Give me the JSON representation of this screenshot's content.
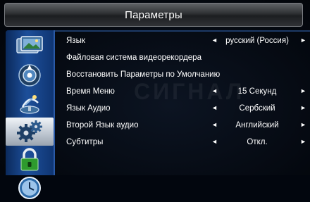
{
  "title": "Параметры",
  "watermark": "СИГНАЛ",
  "sidebar": {
    "items": [
      {
        "icon": "picture-icon",
        "selected": false
      },
      {
        "icon": "sound-icon",
        "selected": false
      },
      {
        "icon": "channel-icon",
        "selected": false
      },
      {
        "icon": "settings-gear-icon",
        "selected": true
      },
      {
        "icon": "lock-icon",
        "selected": false
      },
      {
        "icon": "clock-icon",
        "selected": false
      }
    ]
  },
  "menu": {
    "rows": [
      {
        "label": "Язык",
        "value": "русский (Россия)",
        "has_arrows": true
      },
      {
        "label": "Файловая система видеорекордера",
        "value": "",
        "has_arrows": false
      },
      {
        "label": "Восстановить Параметры по Умолчанию",
        "value": "",
        "has_arrows": false
      },
      {
        "label": "Время Меню",
        "value": "15 Секунд",
        "has_arrows": true
      },
      {
        "label": "Язык Аудио",
        "value": "Сербский",
        "has_arrows": true
      },
      {
        "label": "Второй Язык аудио",
        "value": "Английский",
        "has_arrows": true
      },
      {
        "label": "Субтитры",
        "value": "Откл.",
        "has_arrows": true
      }
    ],
    "arrow_left": "◄",
    "arrow_right": "►"
  }
}
